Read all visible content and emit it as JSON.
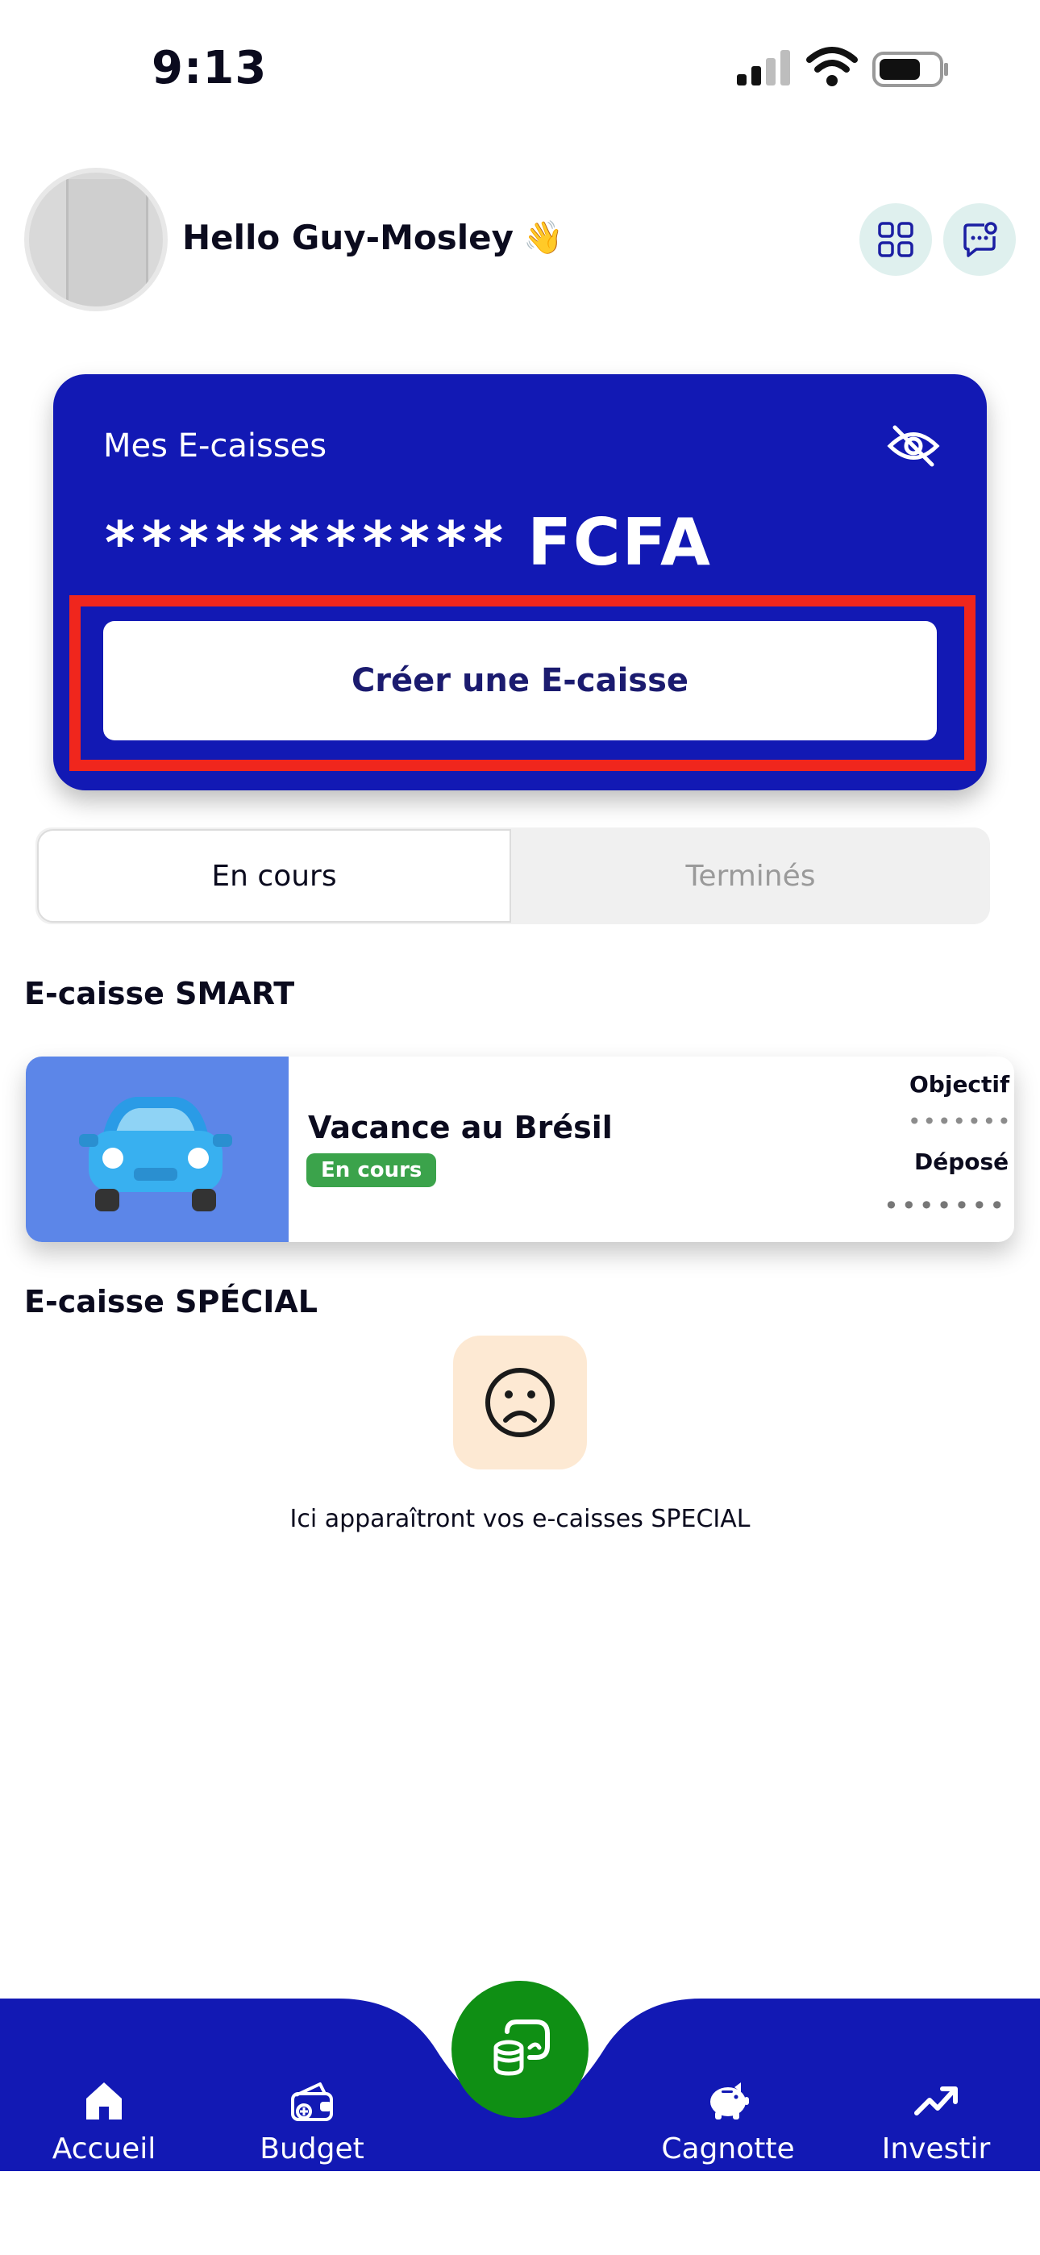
{
  "status_bar": {
    "time": "9:13"
  },
  "header": {
    "greeting": "Hello Guy-Mosley",
    "wave_emoji": "👋",
    "grid_icon": "grid-icon",
    "chat_icon": "chat-icon"
  },
  "card": {
    "title": "Mes E-caisses",
    "masked_amount": "***********",
    "currency": "FCFA",
    "create_button": "Créer une E-caisse",
    "accent_color": "#1219b4",
    "highlight_color": "#f0261d"
  },
  "tabs": {
    "active": "En cours",
    "inactive": "Terminés"
  },
  "smart": {
    "title": "E-caisse SMART",
    "items": [
      {
        "name": "Vacance au Brésil",
        "status": "En cours",
        "objective_label": "Objectif",
        "objective_value": "•••••••",
        "deposit_label": "Déposé",
        "deposit_value": "•••••••"
      }
    ]
  },
  "special": {
    "title": "E-caisse SPÉCIAL",
    "empty_text": "Ici apparaîtront vos e-caisses SPECIAL"
  },
  "nav": {
    "items": [
      {
        "label": "Accueil",
        "icon": "home-icon"
      },
      {
        "label": "Budget",
        "icon": "wallet-icon"
      },
      {
        "label": "Cagnotte",
        "icon": "piggy-bank-icon"
      },
      {
        "label": "Investir",
        "icon": "trend-up-icon"
      }
    ],
    "center_icon": "coins-hand-icon",
    "bar_color": "#1219b4",
    "center_color": "#0f8f14"
  }
}
